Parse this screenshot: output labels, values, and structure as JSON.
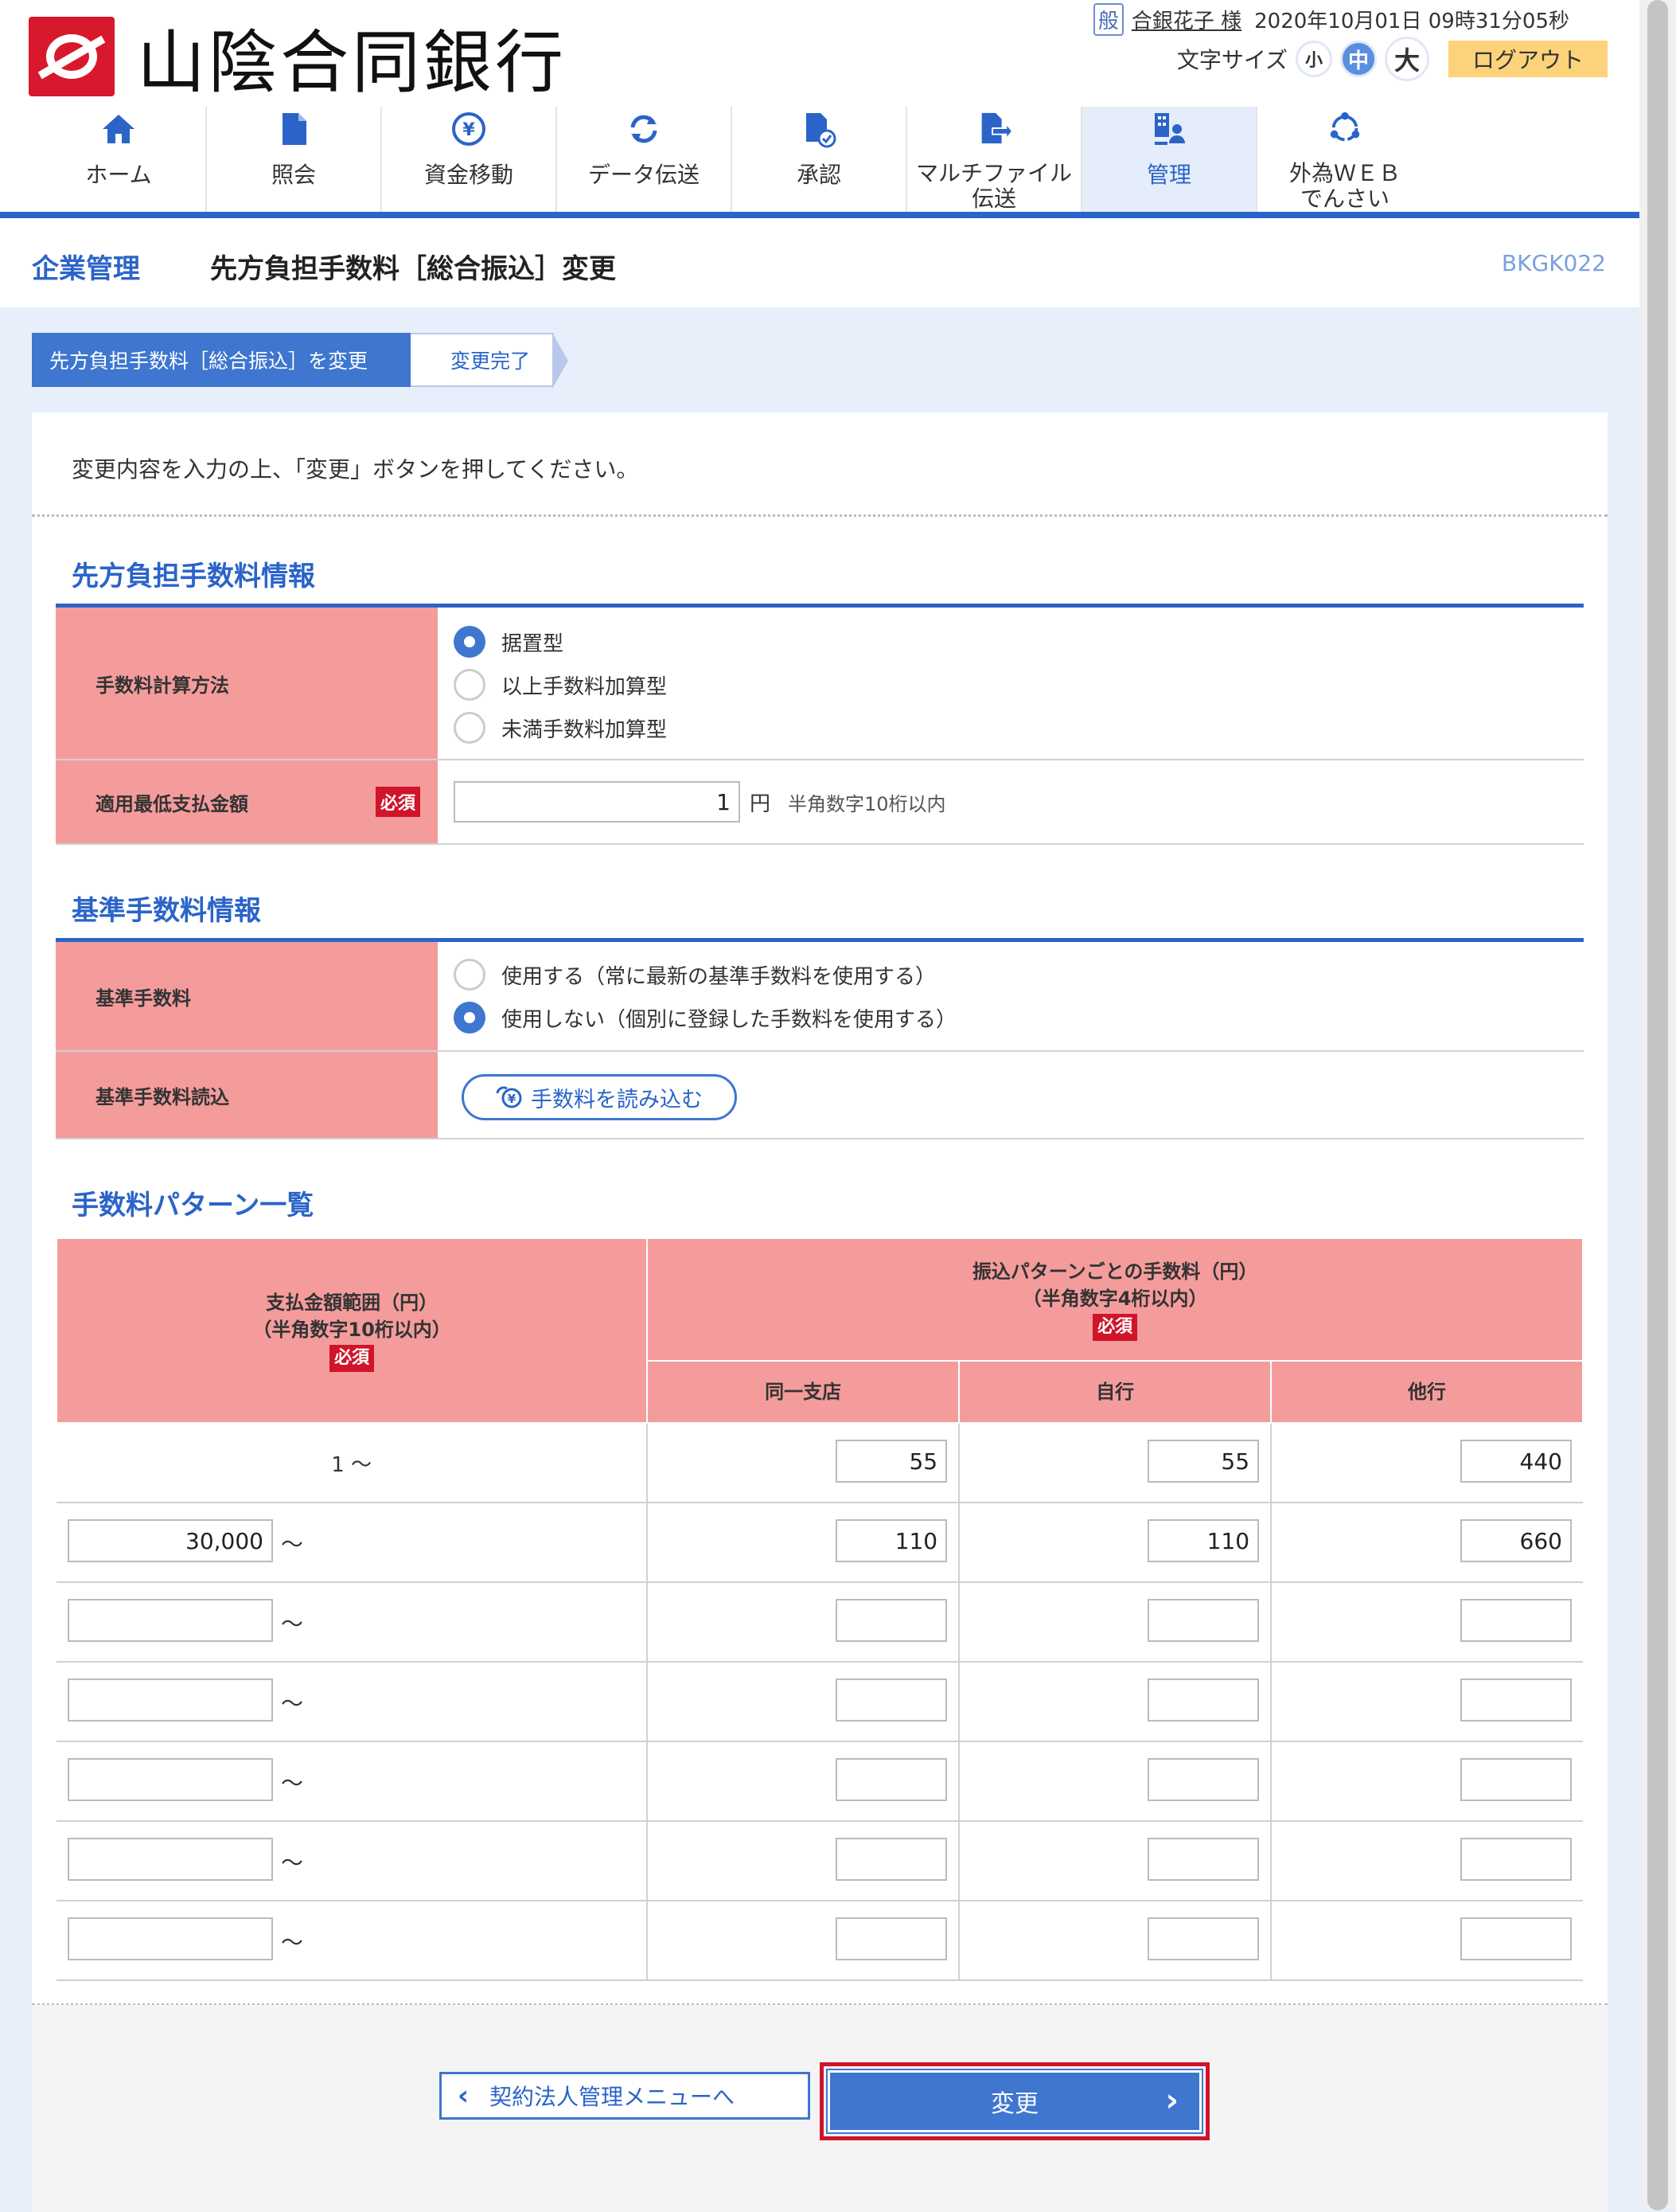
{
  "header": {
    "bank_name": "山陰合同銀行",
    "user_badge": "般",
    "user_name": "合銀花子 様",
    "datetime": "2020年10月01日 09時31分05秒",
    "font_size_label": "文字サイズ",
    "font_sizes": [
      "小",
      "中",
      "大"
    ],
    "logout_label": "ログアウト"
  },
  "nav": {
    "items": [
      {
        "label": "ホーム",
        "icon": "home-icon"
      },
      {
        "label": "照会",
        "icon": "document-icon"
      },
      {
        "label": "資金移動",
        "icon": "yen-transfer-icon"
      },
      {
        "label": "データ伝送",
        "icon": "sync-icon"
      },
      {
        "label": "承認",
        "icon": "approve-icon"
      },
      {
        "label": "マルチファイル\n伝送",
        "icon": "file-send-icon"
      },
      {
        "label": "管理",
        "icon": "admin-icon"
      },
      {
        "label": "外為ＷＥＢ\nでんさい",
        "icon": "forex-icon"
      }
    ],
    "active_index": 6
  },
  "titlebar": {
    "section": "企業管理",
    "page_title": "先方負担手数料［総合振込］変更",
    "screen_id": "BKGK022"
  },
  "steps": [
    "先方負担手数料［総合振込］を変更",
    "変更完了"
  ],
  "intro": "変更内容を入力の上、「変更」ボタンを押してください。",
  "fee_info": {
    "heading": "先方負担手数料情報",
    "calc_label": "手数料計算方法",
    "calc_options": [
      "据置型",
      "以上手数料加算型",
      "未満手数料加算型"
    ],
    "calc_selected": 0,
    "min_label": "適用最低支払金額",
    "required": "必須",
    "min_value": "1",
    "unit": "円",
    "hint": "半角数字10桁以内"
  },
  "base_fee": {
    "heading": "基準手数料情報",
    "base_label": "基準手数料",
    "options": [
      "使用する（常に最新の基準手数料を使用する）",
      "使用しない（個別に登録した手数料を使用する）"
    ],
    "selected": 1,
    "load_label": "基準手数料読込",
    "load_button": "手数料を読み込む"
  },
  "pattern": {
    "heading": "手数料パターン一覧",
    "range_header": "支払金額範囲（円）\n（半角数字10桁以内）",
    "fee_header": "振込パターンごとの手数料（円）\n（半角数字4桁以内）",
    "required": "必須",
    "cols": [
      "同一支店",
      "自行",
      "他行"
    ],
    "tilde": "～",
    "rows": [
      {
        "range": "1 ～",
        "fixed": true,
        "fees": [
          "55",
          "55",
          "440"
        ]
      },
      {
        "range": "30,000",
        "fixed": false,
        "fees": [
          "110",
          "110",
          "660"
        ]
      },
      {
        "range": "",
        "fixed": false,
        "fees": [
          "",
          "",
          ""
        ]
      },
      {
        "range": "",
        "fixed": false,
        "fees": [
          "",
          "",
          ""
        ]
      },
      {
        "range": "",
        "fixed": false,
        "fees": [
          "",
          "",
          ""
        ]
      },
      {
        "range": "",
        "fixed": false,
        "fees": [
          "",
          "",
          ""
        ]
      },
      {
        "range": "",
        "fixed": false,
        "fees": [
          "",
          "",
          ""
        ]
      }
    ]
  },
  "buttons": {
    "back": "契約法人管理メニューへ",
    "change": "変更"
  },
  "colors": {
    "accent": "#2a64c8",
    "label_bg": "#f49c9c",
    "required": "#d0142a",
    "highlight": "#d0142a"
  }
}
